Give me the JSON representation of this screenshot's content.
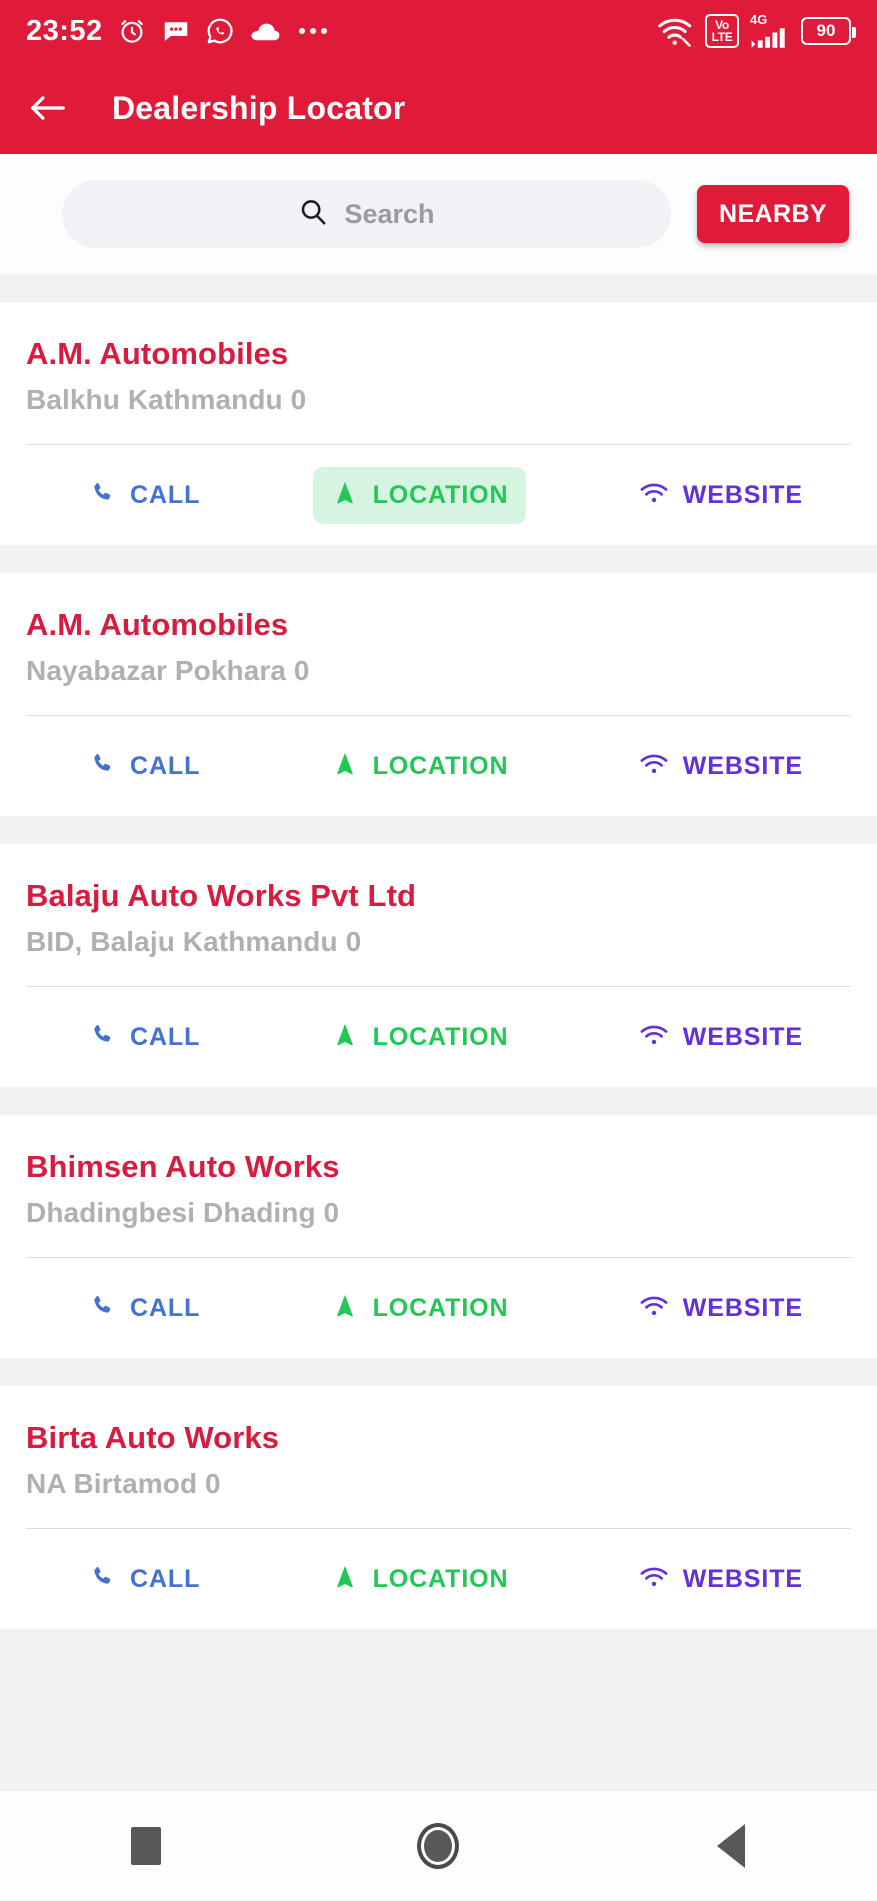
{
  "statusbar": {
    "time": "23:52",
    "left_icons": [
      "alarm-clock-icon",
      "message-icon",
      "whatsapp-icon",
      "cloud-icon",
      "more-dots-icon"
    ],
    "volte_top": "Vo",
    "volte_bottom": "LTE",
    "network_type": "4G",
    "battery_level": "90",
    "right_icons": [
      "wifi-icon",
      "volte-badge",
      "signal-bars-icon",
      "battery-icon"
    ]
  },
  "appbar": {
    "back_icon": "arrow-left-icon",
    "title": "Dealership Locator",
    "background": "#e01b39"
  },
  "search": {
    "icon": "search-icon",
    "placeholder": "Search",
    "value": "",
    "nearby_label": "NEARBY",
    "nearby_color": "#e01b39"
  },
  "actions": {
    "call_label": "CALL",
    "call_icon": "phone-icon",
    "call_color": "#4372d0",
    "location_label": "LOCATION",
    "location_icon": "navigation-arrow-icon",
    "location_color": "#23c755",
    "location_highlight": "#d6f5e1",
    "website_label": "WEBSITE",
    "website_icon": "wifi-icon",
    "website_color": "#6430d8"
  },
  "dealers": [
    {
      "name": "A.M. Automobiles",
      "address": "Balkhu Kathmandu 0",
      "location_pressed": true
    },
    {
      "name": "A.M. Automobiles",
      "address": "Nayabazar Pokhara 0",
      "location_pressed": false
    },
    {
      "name": "Balaju Auto Works Pvt Ltd",
      "address": "BID, Balaju Kathmandu 0",
      "location_pressed": false
    },
    {
      "name": "Bhimsen Auto Works",
      "address": "Dhadingbesi Dhading 0",
      "location_pressed": false
    },
    {
      "name": "Birta Auto Works",
      "address": "NA Birtamod 0",
      "location_pressed": false
    }
  ],
  "navbar": {
    "recents_icon": "square-icon",
    "home_icon": "circle-icon",
    "back_icon": "triangle-left-icon"
  },
  "theme": {
    "brand_red": "#e01b39",
    "title_red": "#d81c3f",
    "address_gray": "#b0b0b4",
    "page_bg": "#f2f2f4"
  }
}
